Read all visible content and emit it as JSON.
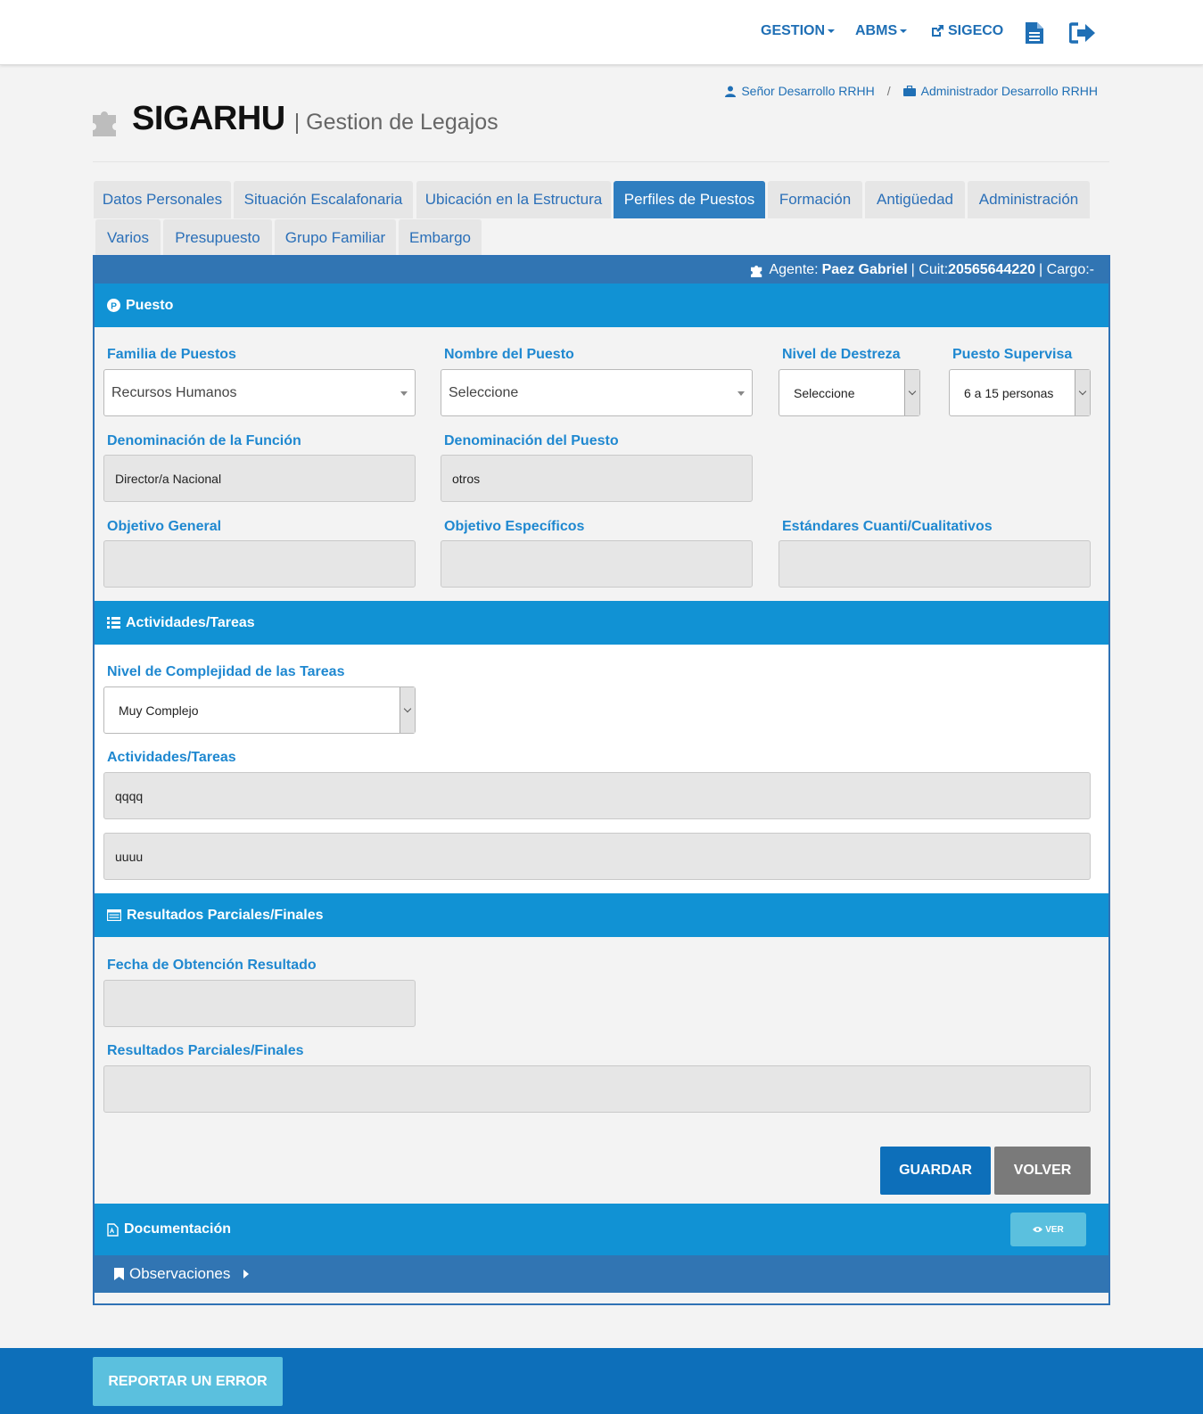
{
  "nav": {
    "gestion": "GESTION",
    "abms": "ABMS",
    "sigeco": "SIGECO"
  },
  "user": {
    "name": "Señor Desarrollo RRHH",
    "separator": "/",
    "role": "Administrador Desarrollo RRHH"
  },
  "brand": {
    "logo": "SIGARHU",
    "subtitle": "| Gestion de Legajos"
  },
  "tabs": [
    {
      "label": "Datos Personales"
    },
    {
      "label": "Situación Escalafonaria"
    },
    {
      "label": "Ubicación en la Estructura"
    },
    {
      "label": "Perfiles de Puestos",
      "active": true
    },
    {
      "label": "Formación"
    },
    {
      "label": "Antigüedad"
    },
    {
      "label": "Administración"
    },
    {
      "label": "Varios"
    },
    {
      "label": "Presupuesto"
    },
    {
      "label": "Grupo Familiar"
    },
    {
      "label": "Embargo"
    }
  ],
  "agent": {
    "label": "Agente:",
    "name": "Paez Gabriel",
    "cuit_label": "| Cuit:",
    "cuit": "20565644220",
    "cargo_label": "| Cargo:-"
  },
  "puesto": {
    "title": "Puesto",
    "familia_label": "Familia de Puestos",
    "familia_value": "Recursos Humanos",
    "nombre_label": "Nombre del Puesto",
    "nombre_value": "Seleccione",
    "nivel_label": "Nivel de Destreza",
    "nivel_value": "Seleccione",
    "supervisa_label": "Puesto Supervisa",
    "supervisa_value": "6 a 15 personas",
    "den_funcion_label": "Denominación de la Función",
    "den_funcion_value": "Director/a Nacional",
    "den_puesto_label": "Denominación del Puesto",
    "den_puesto_value": "otros",
    "obj_general_label": "Objetivo General",
    "obj_general_value": "",
    "obj_especificos_label": "Objetivo Específicos",
    "obj_especificos_value": "",
    "estandares_label": "Estándares Cuanti/Cualitativos",
    "estandares_value": ""
  },
  "actividades": {
    "title": "Actividades/Tareas",
    "complejidad_label": "Nivel de Complejidad de las Tareas",
    "complejidad_value": "Muy Complejo",
    "tareas_label": "Actividades/Tareas",
    "tarea_1": "qqqq",
    "tarea_2": "uuuu"
  },
  "resultados": {
    "title": "Resultados Parciales/Finales",
    "fecha_label": "Fecha de Obtención Resultado",
    "fecha_value": "",
    "resultados_label": "Resultados Parciales/Finales",
    "resultados_value": ""
  },
  "buttons": {
    "guardar": "GUARDAR",
    "volver": "VOLVER",
    "ver": "VER",
    "reportar": "REPORTAR UN ERROR"
  },
  "documentacion": {
    "title": "Documentación"
  },
  "observaciones": {
    "title": "Observaciones"
  },
  "colors": {
    "primary": "#1f6fb5",
    "section": "#1192d4",
    "agent_bar": "#3175b3",
    "footer": "#0d6fba",
    "info": "#5bc0de",
    "gray_button": "#7a7a7a"
  },
  "icons": [
    "document-icon",
    "sign-out-icon",
    "external-link-icon",
    "user-icon",
    "briefcase-icon",
    "puzzle-icon",
    "list-icon",
    "table-icon",
    "pdf-icon",
    "eye-icon",
    "bookmark-icon",
    "caret-right-icon"
  ]
}
